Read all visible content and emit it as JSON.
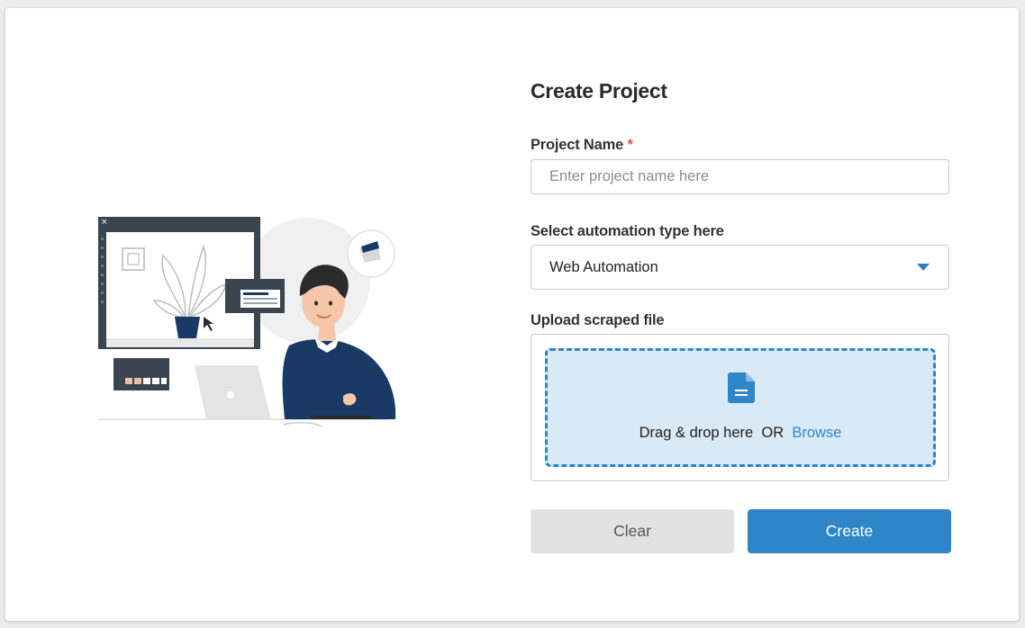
{
  "form": {
    "title": "Create Project",
    "project_name": {
      "label": "Project Name",
      "required_mark": "*",
      "placeholder": "Enter project name here",
      "value": ""
    },
    "automation_type": {
      "label": "Select automation type here",
      "selected": "Web Automation"
    },
    "upload": {
      "label": "Upload scraped file",
      "drop_text": "Drag & drop here",
      "or_text": "OR",
      "browse_label": "Browse"
    },
    "buttons": {
      "clear_label": "Clear",
      "create_label": "Create"
    }
  },
  "colors": {
    "accent": "#2e86c8",
    "dropzone_bg": "#d9e9f6",
    "required": "#e05252",
    "navy": "#1a3a66"
  },
  "icons": {
    "dropdown": "chevron-down-icon",
    "file": "file-icon",
    "window_close": "close-icon"
  }
}
